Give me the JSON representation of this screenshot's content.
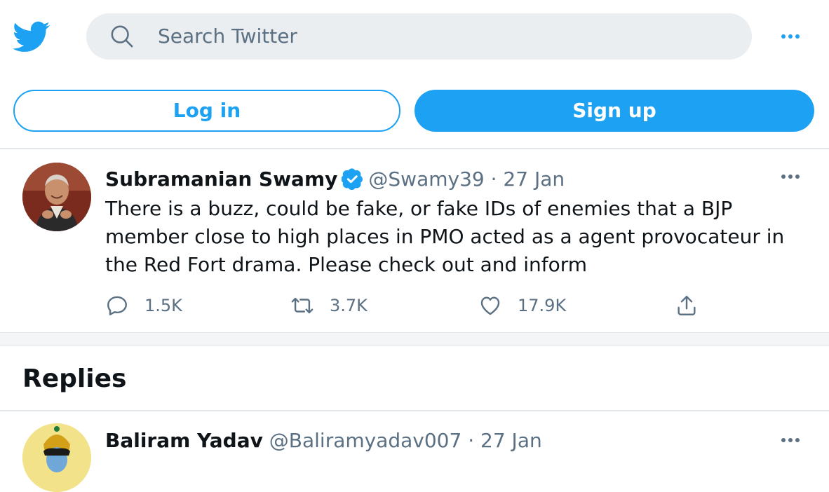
{
  "header": {
    "logo_icon": "twitter-bird-icon",
    "search_placeholder": "Search Twitter",
    "more_icon": "more-horizontal-icon"
  },
  "auth": {
    "login_label": "Log in",
    "signup_label": "Sign up"
  },
  "tweet": {
    "author_name": "Subramanian Swamy",
    "handle": "@Swamy39",
    "separator": "·",
    "date": "27 Jan",
    "text": "There is a buzz, could be fake, or fake IDs of enemies that a BJP member close to high places in PMO acted as a agent provocateur in the Red Fort drama. Please check out and inform",
    "actions": {
      "reply_count": "1.5K",
      "retweet_count": "3.7K",
      "like_count": "17.9K"
    }
  },
  "replies_heading": "Replies",
  "reply": {
    "author_name": "Baliram Yadav",
    "handle": "@Baliramyadav007",
    "separator": "·",
    "date": "27 Jan"
  },
  "colors": {
    "accent": "#1da1f2",
    "text": "#0f1419",
    "secondary": "#5b7083",
    "search_bg": "#ebeef0"
  }
}
